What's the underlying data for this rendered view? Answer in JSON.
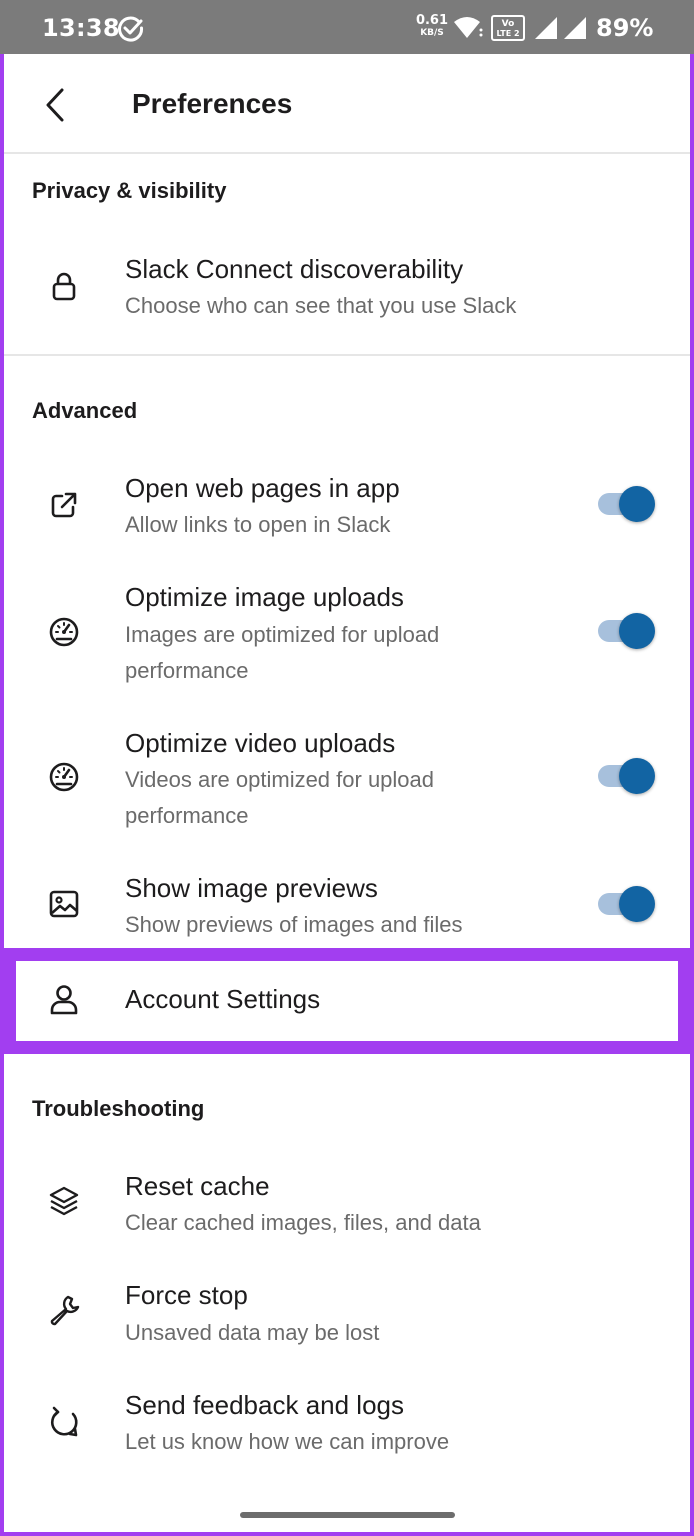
{
  "status_bar": {
    "time": "13:38",
    "net_speed_value": "0.61",
    "net_speed_unit": "KB/S",
    "lte_label_top": "Vo",
    "lte_label_bottom": "LTE 2",
    "battery": "89%"
  },
  "header": {
    "title": "Preferences"
  },
  "sections": {
    "privacy": {
      "title": "Privacy & visibility",
      "items": [
        {
          "title": "Slack Connect discoverability",
          "subtitle": "Choose who can see that you use Slack",
          "icon": "lock-icon"
        }
      ]
    },
    "advanced": {
      "title": "Advanced",
      "items": [
        {
          "title": "Open web pages in app",
          "subtitle": "Allow links to open in Slack",
          "icon": "external-link-icon",
          "enabled": true
        },
        {
          "title": "Optimize image uploads",
          "subtitle_line1": "Images are optimized for upload",
          "subtitle_line2": "performance",
          "icon": "speedometer-icon",
          "enabled": true
        },
        {
          "title": "Optimize video uploads",
          "subtitle_line1": "Videos are optimized for upload",
          "subtitle_line2": "performance",
          "icon": "speedometer-icon",
          "enabled": true
        },
        {
          "title": "Show image previews",
          "subtitle": "Show previews of images and files",
          "icon": "image-icon",
          "enabled": true
        }
      ]
    },
    "account": {
      "title": "Account Settings",
      "icon": "user-icon"
    },
    "troubleshooting": {
      "title": "Troubleshooting",
      "items": [
        {
          "title": "Reset cache",
          "subtitle": "Clear cached images, files, and data",
          "icon": "layers-icon"
        },
        {
          "title": "Force stop",
          "subtitle": "Unsaved data may be lost",
          "icon": "wrench-icon"
        },
        {
          "title": "Send feedback and logs",
          "subtitle": "Let us know how we can improve",
          "icon": "refresh-feedback-icon"
        }
      ]
    }
  },
  "colors": {
    "accent": "#1264a3",
    "highlight": "#a23ef0",
    "status_bar": "#7b7b7b"
  }
}
